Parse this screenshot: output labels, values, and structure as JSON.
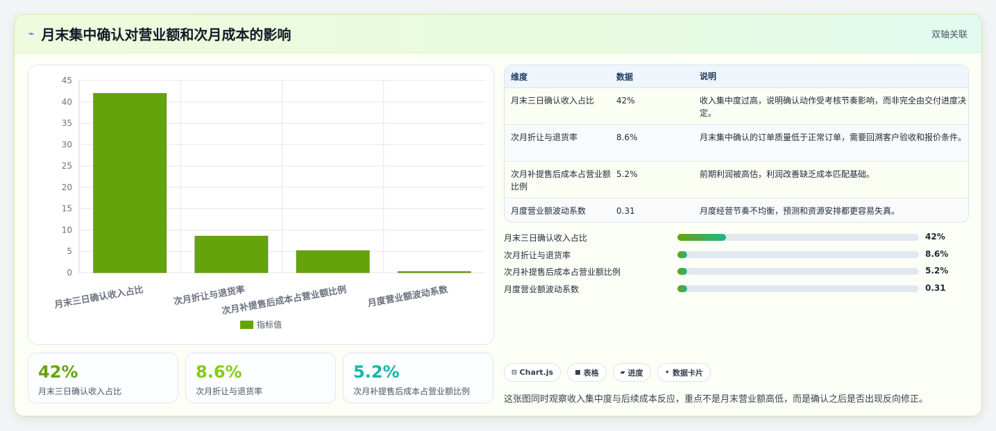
{
  "header": {
    "title": "月末集中确认对营业额和次月成本的影响",
    "tag": "双轴关联",
    "icon": "line-chart-icon"
  },
  "chart_data": {
    "type": "bar",
    "categories": [
      "月末三日确认收入占比",
      "次月折让与退货率",
      "次月补提售后成本占营业额比例",
      "月度营业额波动系数"
    ],
    "series": [
      {
        "name": "指标值",
        "values": [
          42,
          8.6,
          5.2,
          0.31
        ]
      }
    ],
    "ylim": [
      0,
      45
    ],
    "yticks": [
      0,
      5,
      10,
      15,
      20,
      25,
      30,
      35,
      40,
      45
    ],
    "color": "#65a30d",
    "legend": "bottom",
    "grid": true
  },
  "kpis": [
    {
      "value": "42%",
      "label": "月末三日确认收入占比",
      "color": "#65a30d"
    },
    {
      "value": "8.6%",
      "label": "次月折让与退货率",
      "color": "#84cc16"
    },
    {
      "value": "5.2%",
      "label": "次月补提售后成本占营业额比例",
      "color": "#14b8a6"
    }
  ],
  "table": {
    "headers": [
      "维度",
      "数据",
      "说明"
    ],
    "rows": [
      {
        "dim": "月末三日确认收入占比",
        "val": "42%",
        "desc": "收入集中度过高，说明确认动作受考核节奏影响，而非完全由交付进度决定。"
      },
      {
        "dim": "次月折让与退货率",
        "val": "8.6%",
        "desc": "月末集中确认的订单质量低于正常订单，需要回溯客户验收和报价条件。"
      },
      {
        "dim": "次月补提售后成本占营业额比例",
        "val": "5.2%",
        "desc": "前期利润被高估，利润改善缺乏成本匹配基础。"
      },
      {
        "dim": "月度营业额波动系数",
        "val": "0.31",
        "desc": "月度经营节奏不均衡，预测和资源安排都更容易失真。"
      }
    ]
  },
  "progress": [
    {
      "label": "月末三日确认收入占比",
      "value": "42%",
      "fraction": 0.2
    },
    {
      "label": "次月折让与退货率",
      "value": "8.6%",
      "fraction": 0.04
    },
    {
      "label": "次月补提售后成本占营业额比例",
      "value": "5.2%",
      "fraction": 0.04
    },
    {
      "label": "月度营业额波动系数",
      "value": "0.31",
      "fraction": 0.04
    }
  ],
  "chips": [
    {
      "label": "Chart.js",
      "icon": "chart-icon",
      "glyph": "⊟"
    },
    {
      "label": "表格",
      "icon": "table-icon",
      "glyph": "■"
    },
    {
      "label": "进度",
      "icon": "progress-icon",
      "glyph": "▰"
    },
    {
      "label": "数据卡片",
      "icon": "card-icon",
      "glyph": "✦"
    }
  ],
  "note": "这张图同时观察收入集中度与后续成本反应，重点不是月末营业额高低，而是确认之后是否出现反向修正。"
}
